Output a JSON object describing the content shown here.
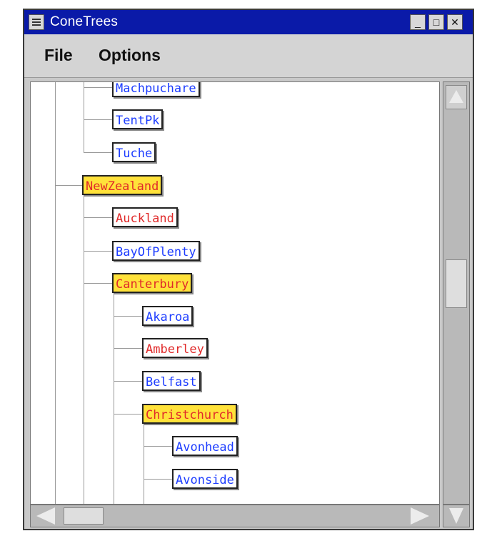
{
  "window": {
    "title": "ConeTrees",
    "controls": {
      "minimize": "_",
      "maximize": "□",
      "close": "✕"
    }
  },
  "menu": [
    "File",
    "Options"
  ],
  "tree": {
    "nodes": [
      {
        "label": "Machpuchare",
        "color": "blue",
        "kind": "leaf"
      },
      {
        "label": "TentPk",
        "color": "blue",
        "kind": "leaf"
      },
      {
        "label": "Tuche",
        "color": "blue",
        "kind": "leaf"
      },
      {
        "label": "NewZealand",
        "color": "folder",
        "kind": "folder"
      },
      {
        "label": "Auckland",
        "color": "red",
        "kind": "leaf"
      },
      {
        "label": "BayOfPlenty",
        "color": "blue",
        "kind": "leaf"
      },
      {
        "label": "Canterbury",
        "color": "folder",
        "kind": "folder"
      },
      {
        "label": "Akaroa",
        "color": "blue",
        "kind": "leaf"
      },
      {
        "label": "Amberley",
        "color": "red",
        "kind": "leaf"
      },
      {
        "label": "Belfast",
        "color": "blue",
        "kind": "leaf"
      },
      {
        "label": "Christchurch",
        "color": "folder",
        "kind": "folder"
      },
      {
        "label": "Avonhead",
        "color": "blue",
        "kind": "leaf"
      },
      {
        "label": "Avonside",
        "color": "blue",
        "kind": "leaf"
      }
    ]
  },
  "colors": {
    "titlebar": "#0a1aa8",
    "folder_fill": "#ffe23a",
    "folder_text": "#e02a2a",
    "leaf_blue": "#1c3cff",
    "leaf_red": "#e02a2a"
  }
}
